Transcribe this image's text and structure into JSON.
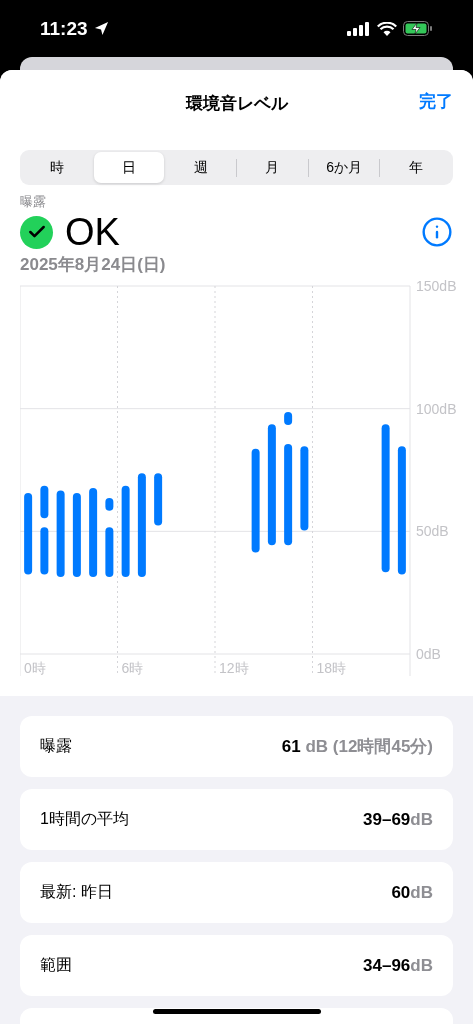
{
  "status_bar": {
    "time": "11:23"
  },
  "header": {
    "title": "環境音レベル",
    "done": "完了"
  },
  "segments": [
    {
      "label": "時",
      "selected": false
    },
    {
      "label": "日",
      "selected": true
    },
    {
      "label": "週",
      "selected": false
    },
    {
      "label": "月",
      "selected": false
    },
    {
      "label": "6か月",
      "selected": false
    },
    {
      "label": "年",
      "selected": false
    }
  ],
  "summary": {
    "label": "曝露",
    "status": "OK",
    "ok": true,
    "date": "2025年8月24日(日)"
  },
  "chart": {
    "y_labels": [
      "150dB",
      "100dB",
      "50dB",
      "0dB"
    ],
    "x_labels": [
      "0時",
      "6時",
      "12時",
      "18時"
    ]
  },
  "stats": [
    {
      "label": "曝露",
      "value": "61",
      "unit": " dB (12時間45分)"
    },
    {
      "label": "1時間の平均",
      "value": "39–69",
      "unit": "dB"
    },
    {
      "label": "最新: 昨日",
      "value": "60",
      "unit": "dB"
    },
    {
      "label": "範囲",
      "value": "34–96",
      "unit": "dB"
    }
  ]
}
